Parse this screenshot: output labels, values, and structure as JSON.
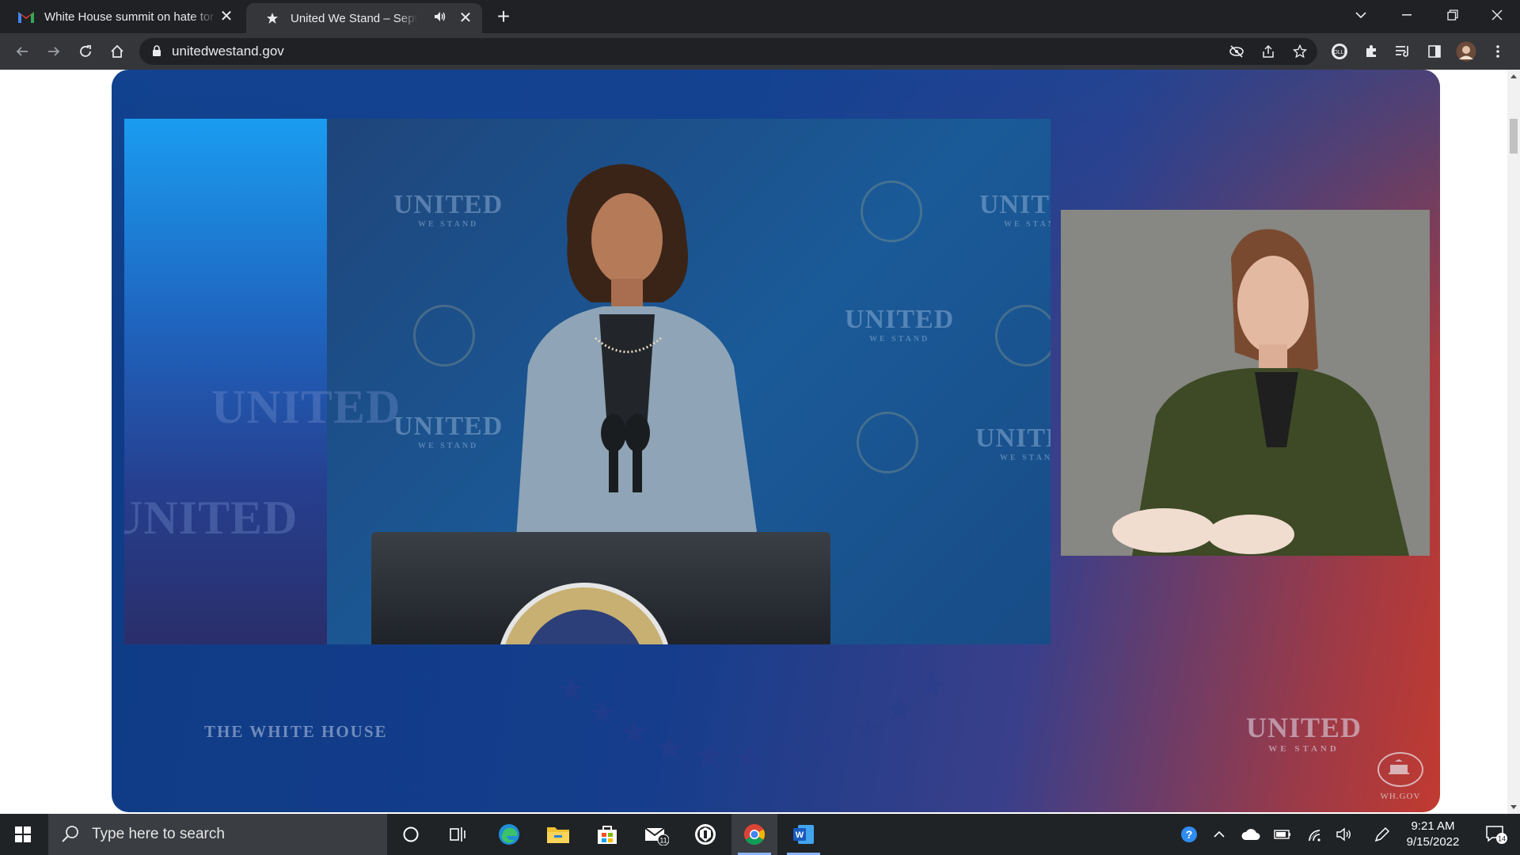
{
  "browser": {
    "tabs": [
      {
        "title": "White House summit on hate tor",
        "favicon": "gmail-favicon"
      },
      {
        "title": "United We Stand – September",
        "favicon": "star-favicon",
        "audio": true
      }
    ],
    "new_tab": "+",
    "address": "unitedwestand.gov"
  },
  "video": {
    "watermark_united": "UNITED",
    "watermark_we_stand": "WE STAND",
    "white_house_label": "THE WHITE HOUSE",
    "brand_big": "UNITED",
    "brand_small": "WE STAND",
    "whgov_label": "WH.GOV"
  },
  "taskbar": {
    "search_placeholder": "Type here to search",
    "mail_badge": "11",
    "time": "9:21 AM",
    "date": "9/15/2022",
    "notification_count": "14"
  }
}
